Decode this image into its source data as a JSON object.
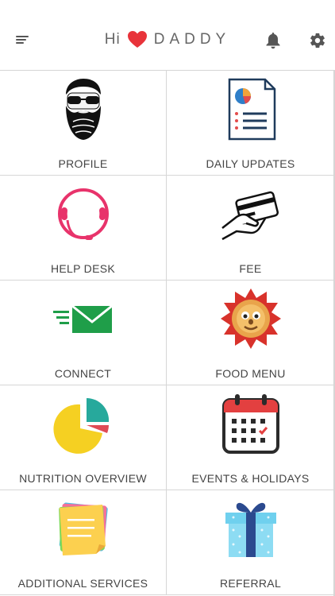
{
  "header": {
    "greeting": "Hi",
    "name": "DADDY",
    "icons": {
      "menu": "menu-lines-icon",
      "heart": "heart-icon",
      "bell": "bell-icon",
      "gear": "gear-icon"
    },
    "heart_color": "#e8333a"
  },
  "tiles": [
    {
      "label": "PROFILE",
      "icon": "bearded-man-icon"
    },
    {
      "label": "DAILY UPDATES",
      "icon": "report-document-icon"
    },
    {
      "label": "HELP DESK",
      "icon": "headset-icon"
    },
    {
      "label": "FEE",
      "icon": "card-payment-icon"
    },
    {
      "label": "CONNECT",
      "icon": "envelope-icon"
    },
    {
      "label": "FOOD MENU",
      "icon": "pancake-face-icon"
    },
    {
      "label": "NUTRITION OVERVIEW",
      "icon": "pie-chart-icon"
    },
    {
      "label": "EVENTS & HOLIDAYS",
      "icon": "calendar-icon"
    },
    {
      "label": "ADDITIONAL SERVICES",
      "icon": "sticky-notes-icon"
    },
    {
      "label": "REFERRAL",
      "icon": "gift-box-icon"
    }
  ]
}
